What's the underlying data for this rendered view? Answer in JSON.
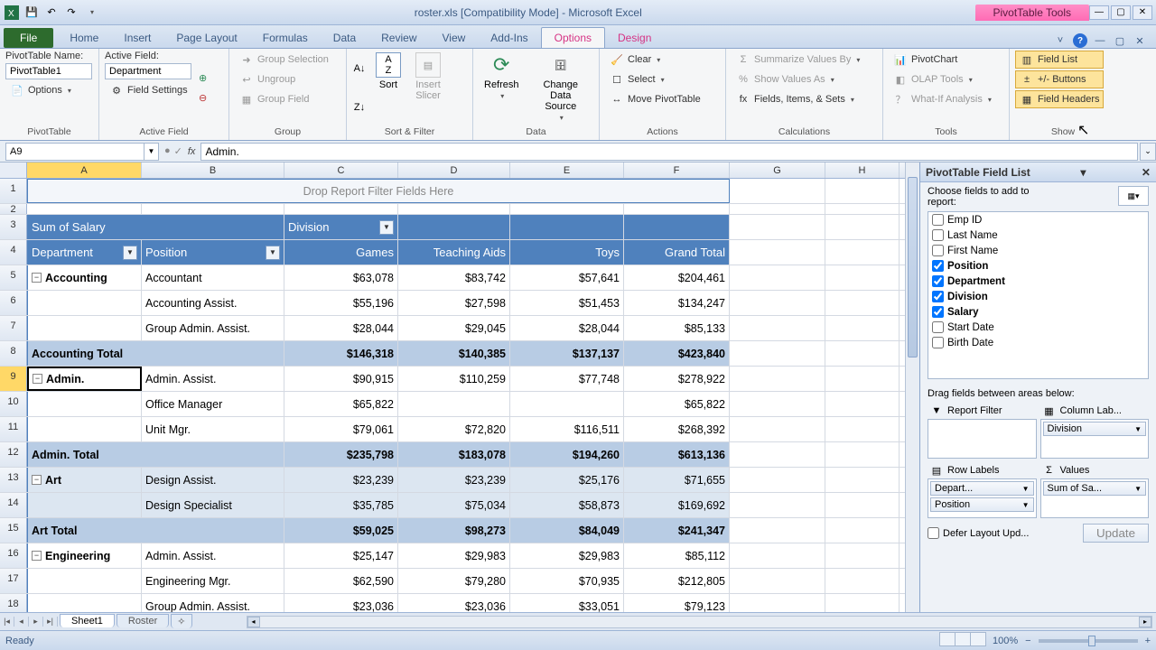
{
  "title": "roster.xls  [Compatibility Mode] - Microsoft Excel",
  "contextual_tool": "PivotTable Tools",
  "tabs": {
    "file": "File",
    "list": [
      "Home",
      "Insert",
      "Page Layout",
      "Formulas",
      "Data",
      "Review",
      "View",
      "Add-Ins"
    ],
    "options": "Options",
    "design": "Design"
  },
  "ribbon": {
    "pivottable": {
      "name_label": "PivotTable Name:",
      "name_value": "PivotTable1",
      "options": "Options",
      "group": "PivotTable"
    },
    "activefield": {
      "label": "Active Field:",
      "value": "Department",
      "settings": "Field Settings",
      "group": "Active Field"
    },
    "groupg": {
      "sel": "Group Selection",
      "ungroup": "Ungroup",
      "field": "Group Field",
      "group": "Group"
    },
    "sortfilter": {
      "sort": "Sort",
      "slicer": "Insert\nSlicer",
      "group": "Sort & Filter"
    },
    "data": {
      "refresh": "Refresh",
      "change": "Change Data\nSource",
      "group": "Data"
    },
    "actions": {
      "clear": "Clear",
      "select": "Select",
      "move": "Move PivotTable",
      "group": "Actions"
    },
    "calc": {
      "summ": "Summarize Values By",
      "show": "Show Values As",
      "fis": "Fields, Items, & Sets",
      "group": "Calculations"
    },
    "tools": {
      "chart": "PivotChart",
      "olap": "OLAP Tools",
      "whatif": "What-If Analysis",
      "group": "Tools"
    },
    "show": {
      "fl": "Field List",
      "pm": "+/- Buttons",
      "fh": "Field Headers",
      "group": "Show"
    }
  },
  "namebox": "A9",
  "formula": "Admin.",
  "cols": [
    "A",
    "B",
    "C",
    "D",
    "E",
    "F",
    "G",
    "H"
  ],
  "filter_placeholder": "Drop Report Filter Fields Here",
  "headers": {
    "measure": "Sum of Salary",
    "colfield": "Division",
    "rowfield1": "Department",
    "rowfield2": "Position",
    "cols": [
      "Games",
      "Teaching Aids",
      "Toys",
      "Grand Total"
    ]
  },
  "rows": [
    {
      "r": 5,
      "dept": "Accounting",
      "pos": "Accountant",
      "v": [
        "$63,078",
        "$83,742",
        "$57,641",
        "$204,461"
      ],
      "first": true
    },
    {
      "r": 6,
      "pos": "Accounting Assist.",
      "v": [
        "$55,196",
        "$27,598",
        "$51,453",
        "$134,247"
      ]
    },
    {
      "r": 7,
      "pos": "Group Admin. Assist.",
      "v": [
        "$28,044",
        "$29,045",
        "$28,044",
        "$85,133"
      ]
    },
    {
      "r": 8,
      "total": "Accounting Total",
      "v": [
        "$146,318",
        "$140,385",
        "$137,137",
        "$423,840"
      ]
    },
    {
      "r": 9,
      "dept": "Admin.",
      "pos": "Admin. Assist.",
      "v": [
        "$90,915",
        "$110,259",
        "$77,748",
        "$278,922"
      ],
      "first": true,
      "sel": true
    },
    {
      "r": 10,
      "pos": "Office Manager",
      "v": [
        "$65,822",
        "",
        "",
        "$65,822"
      ]
    },
    {
      "r": 11,
      "pos": "Unit Mgr.",
      "v": [
        "$79,061",
        "$72,820",
        "$116,511",
        "$268,392"
      ]
    },
    {
      "r": 12,
      "total": "Admin. Total",
      "v": [
        "$235,798",
        "$183,078",
        "$194,260",
        "$613,136"
      ]
    },
    {
      "r": 13,
      "dept": "Art",
      "pos": "Design Assist.",
      "v": [
        "$23,239",
        "$23,239",
        "$25,176",
        "$71,655"
      ],
      "first": true,
      "band": true
    },
    {
      "r": 14,
      "pos": "Design Specialist",
      "v": [
        "$35,785",
        "$75,034",
        "$58,873",
        "$169,692"
      ],
      "band": true
    },
    {
      "r": 15,
      "total": "Art Total",
      "v": [
        "$59,025",
        "$98,273",
        "$84,049",
        "$241,347"
      ]
    },
    {
      "r": 16,
      "dept": "Engineering",
      "pos": "Admin. Assist.",
      "v": [
        "$25,147",
        "$29,983",
        "$29,983",
        "$85,112"
      ],
      "first": true
    },
    {
      "r": 17,
      "pos": "Engineering Mgr.",
      "v": [
        "$62,590",
        "$79,280",
        "$70,935",
        "$212,805"
      ]
    },
    {
      "r": 18,
      "pos": "Group Admin. Assist.",
      "v": [
        "$23,036",
        "$23,036",
        "$33,051",
        "$79,123"
      ]
    }
  ],
  "sheets": {
    "active": "Sheet1",
    "other": "Roster"
  },
  "status": {
    "ready": "Ready",
    "zoom": "100%"
  },
  "pane": {
    "title": "PivotTable Field List",
    "choose": "Choose fields to add to report:",
    "fields": [
      {
        "name": "Emp ID",
        "checked": false
      },
      {
        "name": "Last Name",
        "checked": false
      },
      {
        "name": "First Name",
        "checked": false
      },
      {
        "name": "Position",
        "checked": true
      },
      {
        "name": "Department",
        "checked": true
      },
      {
        "name": "Division",
        "checked": true
      },
      {
        "name": "Salary",
        "checked": true
      },
      {
        "name": "Start Date",
        "checked": false
      },
      {
        "name": "Birth Date",
        "checked": false
      }
    ],
    "drag": "Drag fields between areas below:",
    "areas": {
      "rf": "Report Filter",
      "cl": "Column Lab...",
      "rl": "Row Labels",
      "val": "Values"
    },
    "chips": {
      "col": "Division",
      "row1": "Depart...",
      "row2": "Position",
      "val": "Sum of Sa..."
    },
    "defer": "Defer Layout Upd...",
    "update": "Update"
  }
}
